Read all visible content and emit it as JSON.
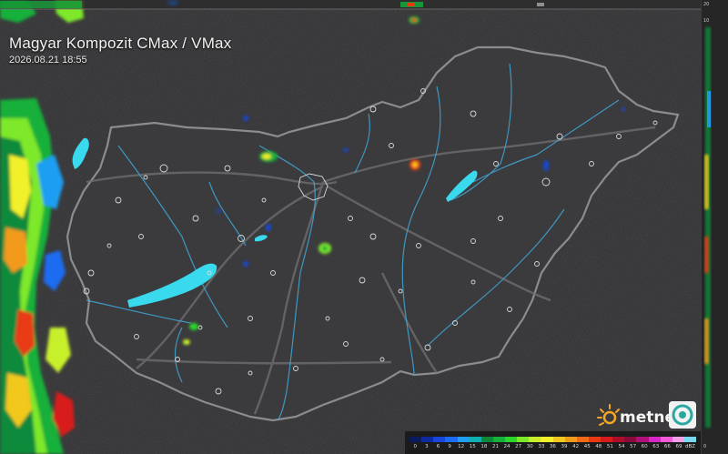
{
  "title": "Magyar Kompozit CMax / VMax",
  "timestamp": "2026.08.21 18:55",
  "brand": {
    "name": "metnet",
    "sun_color": "#f5a623",
    "badge_color": "#2aa8a0"
  },
  "colors": {
    "background": "#2f2f31",
    "country_fill": "#3c3c3e",
    "border": "#8c8c8f",
    "rivers": "#3fa8d8",
    "lakes": "#39d9ee",
    "settlements": "#d9d9d9"
  },
  "legend": {
    "labels": [
      "0",
      "3",
      "6",
      "9",
      "12",
      "15",
      "18",
      "21",
      "24",
      "27",
      "30",
      "33",
      "36",
      "39",
      "42",
      "45",
      "48",
      "51",
      "54",
      "57",
      "60",
      "63",
      "66",
      "69",
      "dBZ"
    ],
    "colors": [
      "#0b1a5c",
      "#0d2a9e",
      "#1746d8",
      "#1b6cf2",
      "#1f9ef2",
      "#10b0b0",
      "#0c8a3a",
      "#14b03a",
      "#2bd62b",
      "#7ee82a",
      "#c8f02a",
      "#f2f02a",
      "#f2c81f",
      "#f29a1a",
      "#f26a15",
      "#e83a12",
      "#d81a1a",
      "#b00d2a",
      "#8a0a3a",
      "#b0107a",
      "#d826c8",
      "#f25ad8",
      "#f2a0e8",
      "#7ad8ee"
    ]
  },
  "side_axis": {
    "labels": [
      "20",
      "10",
      "0"
    ]
  }
}
